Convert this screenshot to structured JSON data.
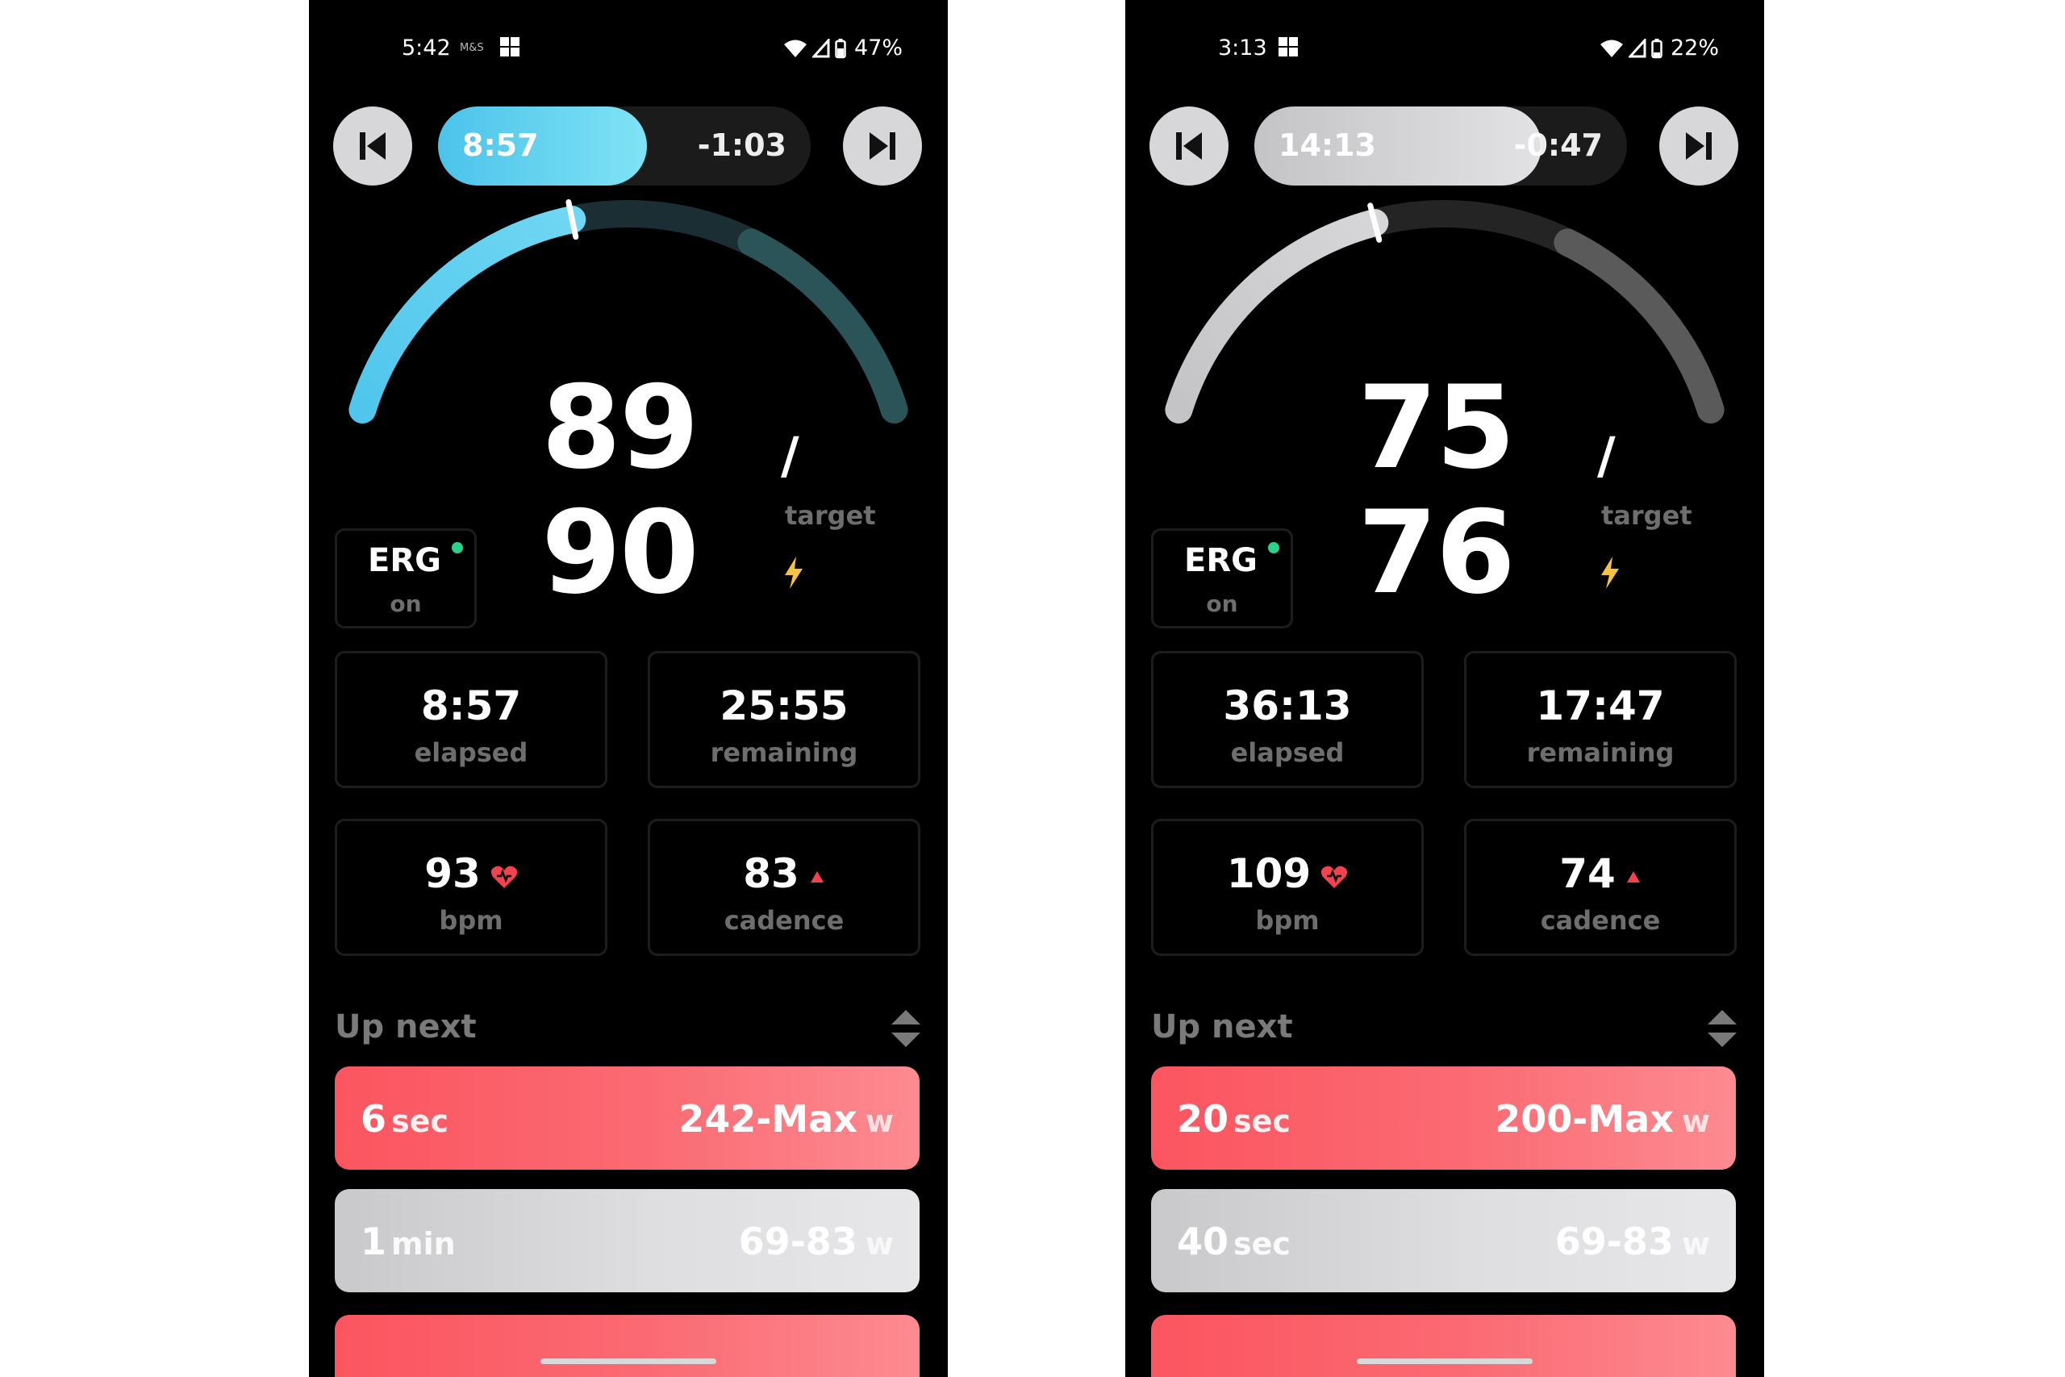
{
  "screens": [
    {
      "status": {
        "time": "5:42",
        "carrier": "M&S",
        "battery": "47%"
      },
      "progress": {
        "elapsed": "8:57",
        "remaining": "-1:03",
        "fill_fraction": 0.56
      },
      "gauge": {
        "fraction": 0.42,
        "theme": "blue"
      },
      "power": {
        "current": "89",
        "target": "90",
        "slash": "/",
        "target_label": "target"
      },
      "erg": {
        "label": "ERG",
        "state": "on"
      },
      "stats": {
        "elapsed": {
          "value": "8:57",
          "label": "elapsed"
        },
        "remaining": {
          "value": "25:55",
          "label": "remaining"
        },
        "heart": {
          "value": "93",
          "label": "bpm"
        },
        "cadence": {
          "value": "83",
          "label": "cadence"
        }
      },
      "up_next": {
        "title": "Up next",
        "items": [
          {
            "duration": "6",
            "unit": "sec",
            "power": "242-Max",
            "power_unit": "w",
            "style": "red"
          },
          {
            "duration": "1",
            "unit": "min",
            "power": "69-83",
            "power_unit": "w",
            "style": "gray"
          }
        ]
      }
    },
    {
      "status": {
        "time": "3:13",
        "carrier": "",
        "battery": "22%"
      },
      "progress": {
        "elapsed": "14:13",
        "remaining": "-0:47",
        "fill_fraction": 0.77
      },
      "gauge": {
        "fraction": 0.4,
        "theme": "gray"
      },
      "power": {
        "current": "75",
        "target": "76",
        "slash": "/",
        "target_label": "target"
      },
      "erg": {
        "label": "ERG",
        "state": "on"
      },
      "stats": {
        "elapsed": {
          "value": "36:13",
          "label": "elapsed"
        },
        "remaining": {
          "value": "17:47",
          "label": "remaining"
        },
        "heart": {
          "value": "109",
          "label": "bpm"
        },
        "cadence": {
          "value": "74",
          "label": "cadence"
        }
      },
      "up_next": {
        "title": "Up next",
        "items": [
          {
            "duration": "20",
            "unit": "sec",
            "power": "200-Max",
            "power_unit": "w",
            "style": "red"
          },
          {
            "duration": "40",
            "unit": "sec",
            "power": "69-83",
            "power_unit": "w",
            "style": "gray"
          }
        ]
      }
    }
  ],
  "colors": {
    "blue_fill": "#4cc3ea",
    "blue_fill_end": "#7fe3f5",
    "gray_fill": "#c8c8ca",
    "accent_red": "#fb5560",
    "heart": "#f0434f",
    "bolt": "#f6c244",
    "erg_dot": "#2bd18a"
  }
}
